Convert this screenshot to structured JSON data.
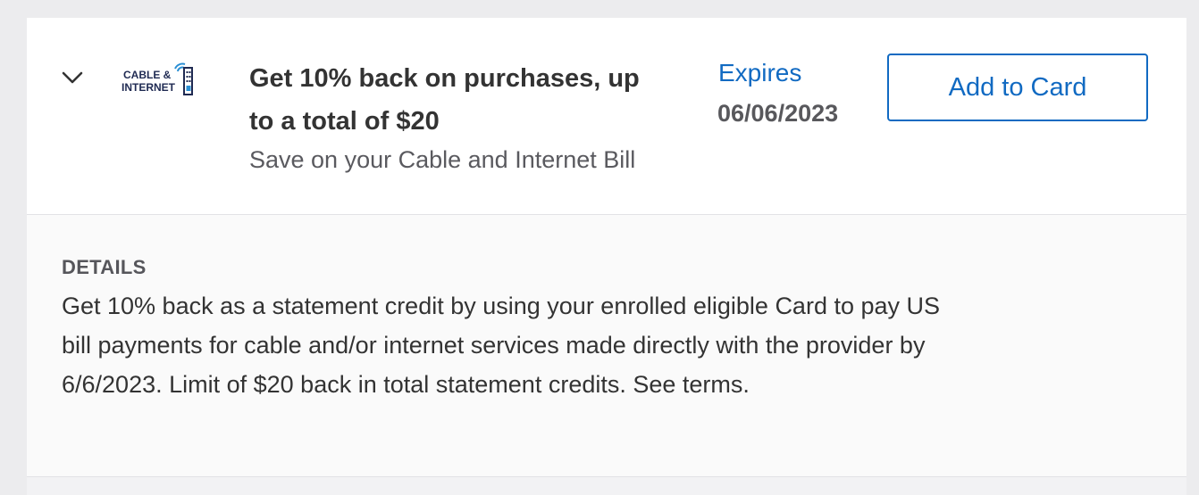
{
  "offer": {
    "logo": {
      "line1": "CABLE &",
      "line2": "INTERNET",
      "icon": "cable-internet-logo-icon"
    },
    "title": "Get 10% back on purchases, up to a total of $20",
    "subtitle": "Save on your Cable and Internet Bill",
    "expires_label": "Expires",
    "expires_date": "06/06/2023",
    "add_button_label": "Add to Card",
    "toggle_icon": "chevron-down-icon"
  },
  "details": {
    "heading": "DETAILS",
    "body": "Get 10% back as a statement credit by using your enrolled eligible Card to pay US bill payments for cable and/or internet services made directly with the provider by 6/6/2023. Limit of $20 back in total statement credits. See terms."
  },
  "colors": {
    "accent": "#116ac2",
    "logo_navy": "#1f2a52",
    "title_text": "#333333",
    "muted_text": "#5a5a5f",
    "page_background": "#ececee"
  }
}
